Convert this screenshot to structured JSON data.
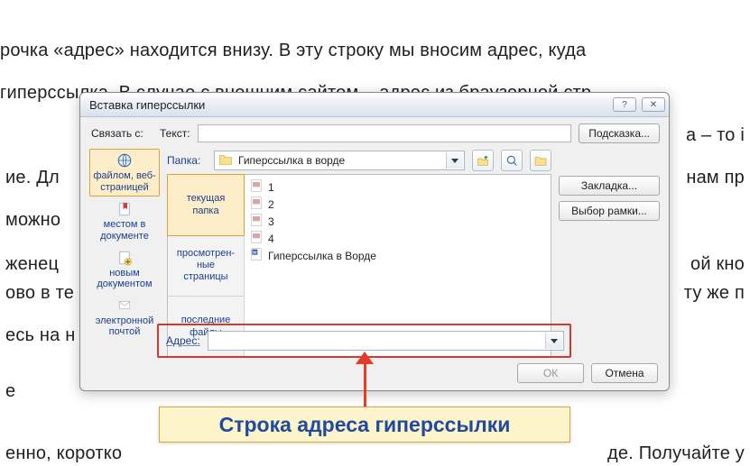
{
  "background_text": {
    "l1": "рочка «адрес» находится внизу. В эту строку мы вносим адрес, куда",
    "l2": "гиперссылка. В случае с внешним сайтом – адрес из браузерной стр",
    "l3_right": "а – то і",
    "l4_right": "нам пр",
    "l5_left": "ие. Дл",
    "l5b_left": "можно",
    "l6_left": "женец",
    "l6_right": "ой кно",
    "l7_left": "ово в те",
    "l7_right": "ту же п",
    "l8_left": "есь на н",
    "l9_left": "е",
    "l10_left": "енно, коротко",
    "l10_right": "де. Получайте у"
  },
  "dialog": {
    "title": "Вставка гиперссылки",
    "help_sym": "?",
    "close_sym": "✕",
    "link_to_label": "Связать с:",
    "text_label": "Текст:",
    "text_value": "",
    "hint_button": "Подсказка...",
    "folder_label": "Папка:",
    "folder_value": "Гиперссылка в ворде",
    "left_items": [
      {
        "label1": "файлом, веб-",
        "label2": "страницей"
      },
      {
        "label1": "местом в",
        "label2": "документе"
      },
      {
        "label1": "новым",
        "label2": "документом"
      },
      {
        "label1": "электронной",
        "label2": "почтой"
      }
    ],
    "browse_tabs": [
      {
        "label1": "текущая",
        "label2": "папка"
      },
      {
        "label1": "просмотрен-",
        "label2": "ные",
        "label3": "страницы"
      },
      {
        "label1": "последние",
        "label2": "файлы"
      }
    ],
    "file_items": [
      "1",
      "2",
      "3",
      "4",
      "Гиперссылка в Ворде"
    ],
    "right_buttons": {
      "bookmark": "Закладка...",
      "frame": "Выбор рамки..."
    },
    "address_label": "Адрес:",
    "address_value": "",
    "ok_label": "ОК",
    "cancel_label": "Отмена"
  },
  "callout": "Строка адреса гиперссылки"
}
